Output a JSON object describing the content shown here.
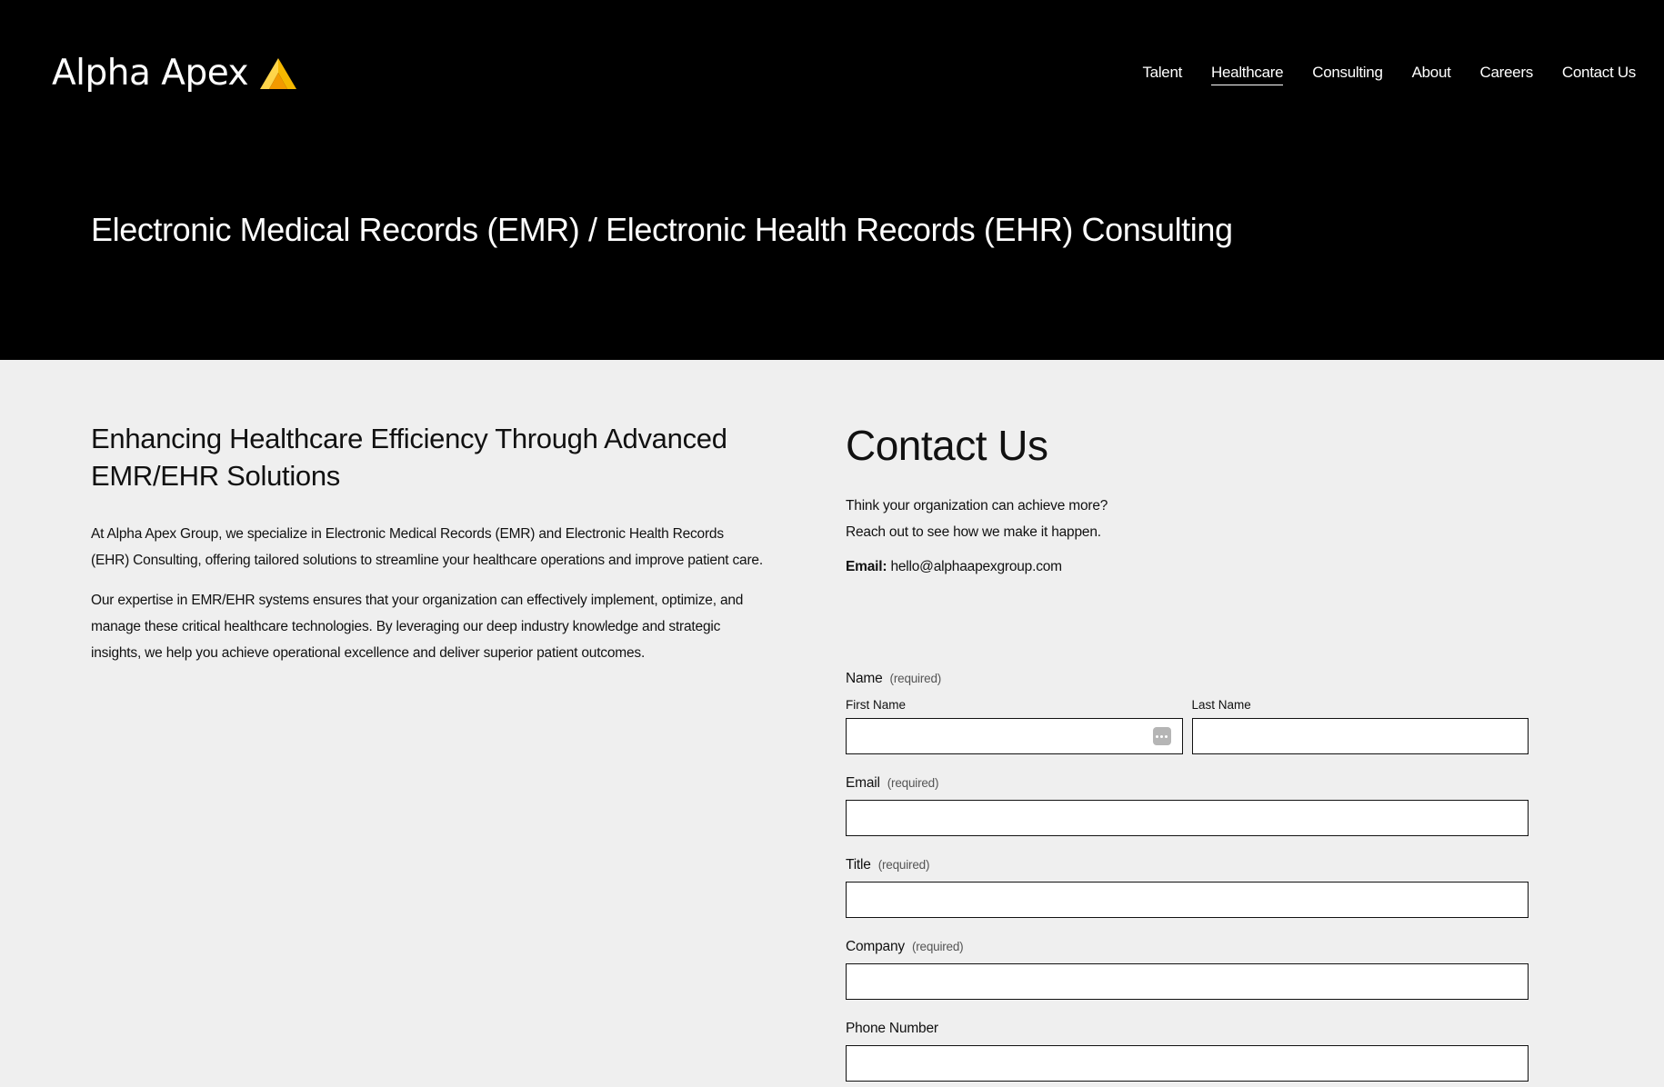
{
  "brand": {
    "name": "Alpha Apex",
    "accent_color": "#f5b800",
    "accent_color_2": "#ffd54a"
  },
  "nav": {
    "items": [
      {
        "label": "Talent",
        "active": false
      },
      {
        "label": "Healthcare",
        "active": true
      },
      {
        "label": "Consulting",
        "active": false
      },
      {
        "label": "About",
        "active": false
      },
      {
        "label": "Careers",
        "active": false
      },
      {
        "label": "Contact Us",
        "active": false
      }
    ]
  },
  "hero": {
    "title": "Electronic Medical Records (EMR) / Electronic Health Records (EHR) Consulting"
  },
  "intro": {
    "heading": "Enhancing Healthcare Efficiency Through Advanced EMR/EHR Solutions",
    "paragraph1": "At Alpha Apex Group, we specialize in Electronic Medical Records (EMR) and Electronic Health Records (EHR) Consulting, offering tailored solutions to streamline your healthcare operations and improve patient care.",
    "paragraph2": "Our expertise in EMR/EHR systems ensures that your organization can effectively implement, optimize, and manage these critical healthcare technologies. By leveraging our deep industry knowledge and strategic insights, we help you achieve operational excellence and deliver superior patient outcomes."
  },
  "contact": {
    "title": "Contact Us",
    "tagline_line1": "Think your organization can achieve more?",
    "tagline_line2": "Reach out to see how we make it happen.",
    "email_label": "Email:",
    "email_value": "hello@alphaapexgroup.com"
  },
  "form": {
    "name_label": "Name",
    "required_text": "(required)",
    "first_name_label": "First Name",
    "first_name_value": "",
    "last_name_label": "Last Name",
    "last_name_value": "",
    "email_label": "Email",
    "email_value": "",
    "title_label": "Title",
    "title_value": "",
    "company_label": "Company",
    "company_value": "",
    "phone_label": "Phone Number",
    "phone_value": ""
  },
  "icons": {
    "logo_mark": "triangle-logo-icon",
    "autofill": "autofill-icon"
  }
}
